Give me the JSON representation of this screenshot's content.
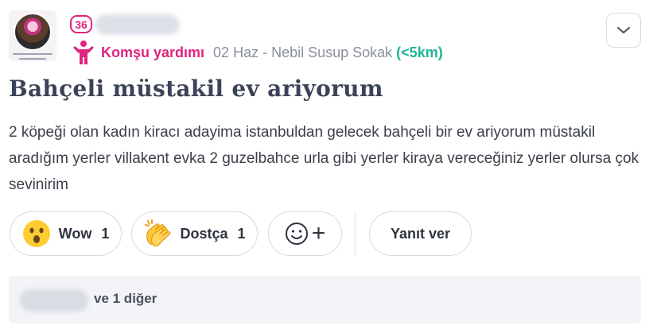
{
  "post": {
    "level": "36",
    "category": "Komşu yardımı",
    "date_location": "02 Haz - Nebil Susup Sokak",
    "distance": "(<5km)",
    "title": "Bahçeli müstakil ev ariyorum",
    "body": "2 köpeği olan kadın kiracı adayima istanbuldan gelecek bahçeli bir ev ariyorum müstakil aradığım yerler villakent evka 2 guzelbahce urla gibi yerler kiraya vereceğiniz yerler olursa çok sevinirim"
  },
  "reactions": [
    {
      "label": "Wow",
      "count": "1",
      "icon": "surprised-face-icon"
    },
    {
      "label": "Dostça",
      "count": "1",
      "icon": "clapping-hands-icon"
    }
  ],
  "add_reaction": {
    "icon": "smiley-face-icon",
    "plus": "+"
  },
  "reply_label": "Yanıt ver",
  "footer": {
    "others_text": "ve 1 diğer"
  },
  "colors": {
    "accent_pink": "#e0247f",
    "distance_green": "#1fb59b",
    "title": "#3c4358"
  }
}
